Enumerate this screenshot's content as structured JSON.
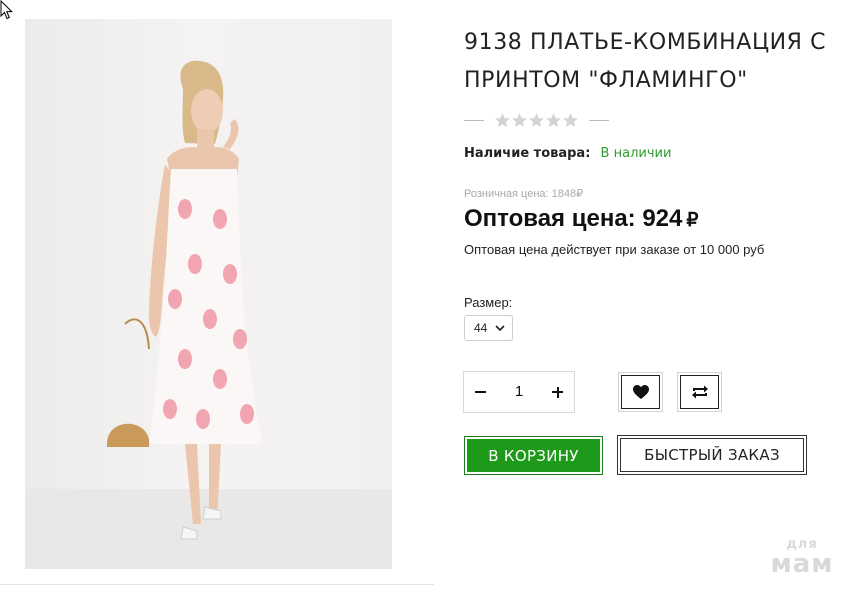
{
  "product": {
    "title": "9138 ПЛАТЬЕ-КОМБИНАЦИЯ С ПРИНТОМ \"ФЛАМИНГО\"",
    "rating": {
      "value": 0,
      "max": 5
    },
    "availability_label": "Наличие товара:",
    "availability_value": "В наличии",
    "retail_price_text": "Розничная цена: 1848₽",
    "wholesale_price_label": "Оптовая цена: 924",
    "currency_symbol": "₽",
    "wholesale_note": "Оптовая цена действует при заказе от 10 000 руб",
    "image_icon": "product-photo"
  },
  "options": {
    "size_label": "Размер:",
    "size_selected": "44"
  },
  "quantity": {
    "value": "1"
  },
  "actions": {
    "add_to_cart": "В КОРЗИНУ",
    "quick_order": "БЫСТРЫЙ ЗАКАЗ",
    "wishlist_icon": "heart-icon",
    "compare_icon": "compare-arrows-icon"
  },
  "watermark": {
    "line1": "для",
    "line2": "мам"
  },
  "colors": {
    "accent_green": "#1e9a1a",
    "in_stock": "#2e9a2e",
    "star_empty": "#d4d4d4"
  }
}
